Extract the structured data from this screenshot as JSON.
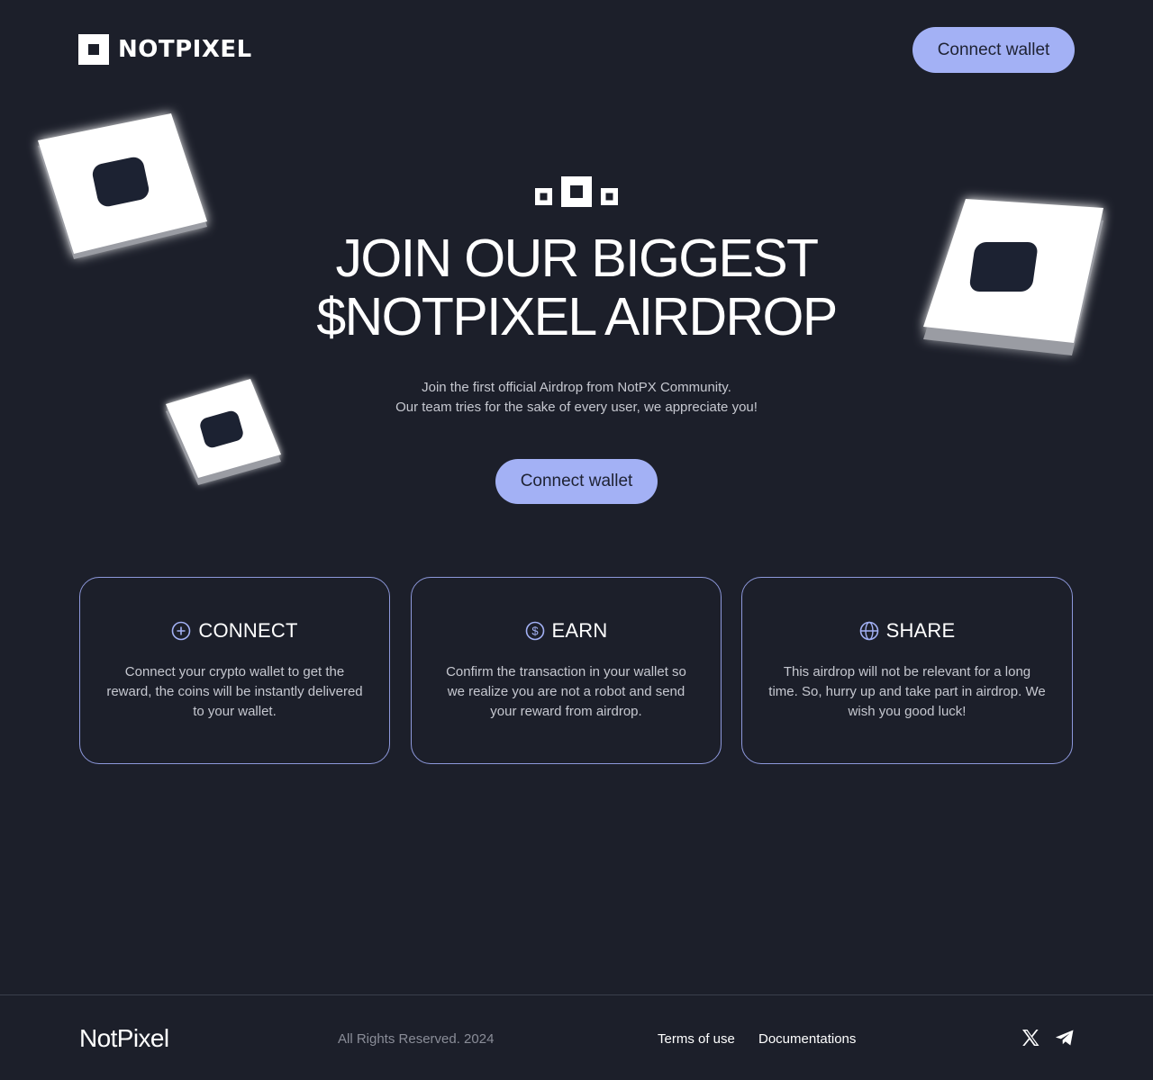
{
  "header": {
    "logo_text": "NOTPIXEL",
    "connect_label": "Connect wallet"
  },
  "hero": {
    "title_line1": "JOIN OUR BIGGEST",
    "title_line2": "$NOTPIXEL AIRDROP",
    "subtitle_line1": "Join the first official Airdrop from NotPX Community.",
    "subtitle_line2": "Our team tries for the sake of every user, we appreciate you!",
    "connect_label": "Connect wallet"
  },
  "cards": [
    {
      "icon": "plus-circle-icon",
      "title": "CONNECT",
      "text": "Connect your crypto wallet to get the reward, the coins will be instantly delivered to your wallet."
    },
    {
      "icon": "dollar-circle-icon",
      "title": "EARN",
      "text": "Confirm the transaction in your wallet so we realize you are not a robot and send your reward from airdrop."
    },
    {
      "icon": "globe-icon",
      "title": "SHARE",
      "text": "This airdrop will not be relevant for a long time. So, hurry up and take part in airdrop. We wish you good luck!"
    }
  ],
  "footer": {
    "brand": "NotPixel",
    "copyright": "All Rights Reserved. 2024",
    "links": [
      "Terms of use",
      "Documentations"
    ],
    "social": [
      "x-icon",
      "telegram-icon"
    ]
  },
  "colors": {
    "background": "#1c1f2a",
    "accent": "#a3b1f5",
    "card_border": "#8d98db"
  }
}
